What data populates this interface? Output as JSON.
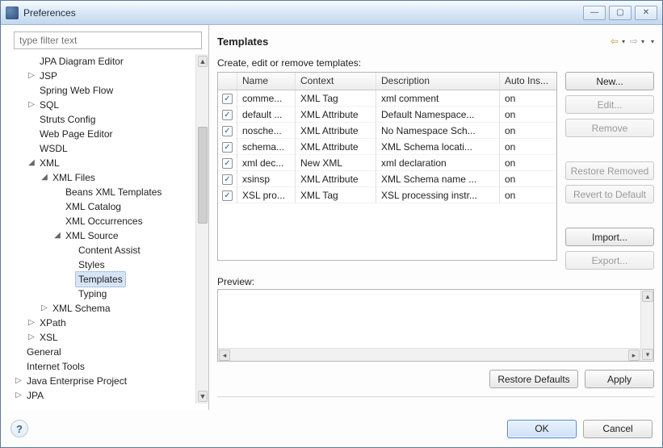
{
  "window": {
    "title": "Preferences"
  },
  "filter": {
    "placeholder": "type filter text"
  },
  "tree": {
    "items": [
      {
        "label": "JPA Diagram Editor",
        "depth": 1,
        "twisty": ""
      },
      {
        "label": "JSP",
        "depth": 1,
        "twisty": "▷"
      },
      {
        "label": "Spring Web Flow",
        "depth": 1,
        "twisty": ""
      },
      {
        "label": "SQL",
        "depth": 1,
        "twisty": "▷"
      },
      {
        "label": "Struts Config",
        "depth": 1,
        "twisty": ""
      },
      {
        "label": "Web Page Editor",
        "depth": 1,
        "twisty": ""
      },
      {
        "label": "WSDL",
        "depth": 1,
        "twisty": ""
      },
      {
        "label": "XML",
        "depth": 1,
        "twisty": "�◢"
      },
      {
        "label": "XML Files",
        "depth": 2,
        "twisty": "▿"
      },
      {
        "label": "Beans XML Templates",
        "depth": 3,
        "twisty": ""
      },
      {
        "label": "XML Catalog",
        "depth": 3,
        "twisty": ""
      },
      {
        "label": "XML Occurrences",
        "depth": 3,
        "twisty": ""
      },
      {
        "label": "XML Source",
        "depth": 3,
        "twisty": "▿"
      },
      {
        "label": "Content Assist",
        "depth": 4,
        "twisty": ""
      },
      {
        "label": "Styles",
        "depth": 4,
        "twisty": ""
      },
      {
        "label": "Templates",
        "depth": 4,
        "twisty": "",
        "selected": true
      },
      {
        "label": "Typing",
        "depth": 4,
        "twisty": ""
      },
      {
        "label": "XML Schema",
        "depth": 2,
        "twisty": "▷"
      },
      {
        "label": "XPath",
        "depth": 1,
        "twisty": "▷"
      },
      {
        "label": "XSL",
        "depth": 1,
        "twisty": "▷"
      },
      {
        "label": "General",
        "depth": 0,
        "twisty": ""
      },
      {
        "label": "Internet Tools",
        "depth": 0,
        "twisty": ""
      },
      {
        "label": "Java Enterprise Project",
        "depth": 0,
        "twisty": "▷"
      },
      {
        "label": "JPA",
        "depth": 0,
        "twisty": "▷"
      }
    ]
  },
  "main": {
    "heading": "Templates",
    "instructions": "Create, edit or remove templates:",
    "previewLabel": "Preview:"
  },
  "table": {
    "headers": {
      "name": "Name",
      "context": "Context",
      "description": "Description",
      "auto": "Auto Ins..."
    },
    "rows": [
      {
        "checked": true,
        "name": "comme...",
        "context": "XML Tag",
        "description": "xml comment",
        "auto": "on"
      },
      {
        "checked": true,
        "name": "default ...",
        "context": "XML Attribute",
        "description": "Default Namespace...",
        "auto": "on"
      },
      {
        "checked": true,
        "name": "nosche...",
        "context": "XML Attribute",
        "description": "No Namespace Sch...",
        "auto": "on"
      },
      {
        "checked": true,
        "name": "schema...",
        "context": "XML Attribute",
        "description": "XML Schema locati...",
        "auto": "on"
      },
      {
        "checked": true,
        "name": "xml dec...",
        "context": "New XML",
        "description": "xml declaration",
        "auto": "on"
      },
      {
        "checked": true,
        "name": "xsinsp",
        "context": "XML Attribute",
        "description": "XML Schema name ...",
        "auto": "on"
      },
      {
        "checked": true,
        "name": "XSL pro...",
        "context": "XML Tag",
        "description": "XSL processing instr...",
        "auto": "on"
      }
    ]
  },
  "buttons": {
    "new": "New...",
    "edit": "Edit...",
    "remove": "Remove",
    "restoreRemoved": "Restore Removed",
    "revertDefault": "Revert to Default",
    "import": "Import...",
    "export": "Export...",
    "restoreDefaults": "Restore Defaults",
    "apply": "Apply",
    "ok": "OK",
    "cancel": "Cancel"
  }
}
